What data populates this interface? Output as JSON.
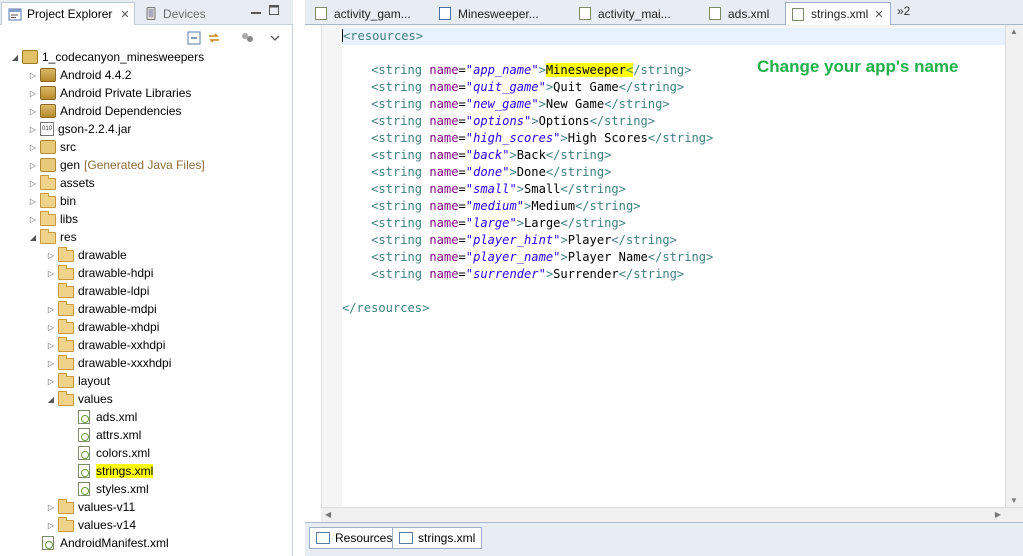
{
  "left_panel": {
    "tabs": [
      {
        "label": "Project Explorer",
        "active": true
      },
      {
        "label": "Devices",
        "active": false
      }
    ],
    "close_glyph": "✕",
    "tree": [
      {
        "label": "1_codecanyon_minesweepers",
        "icon": "project-icon",
        "twisty": "expanded",
        "depth": 0
      },
      {
        "label": "Android 4.4.2",
        "icon": "library-icon",
        "twisty": "collapsed",
        "depth": 1
      },
      {
        "label": "Android Private Libraries",
        "icon": "library-icon",
        "twisty": "collapsed",
        "depth": 1
      },
      {
        "label": "Android Dependencies",
        "icon": "library-icon",
        "twisty": "collapsed",
        "depth": 1
      },
      {
        "label": "gson-2.2.4.jar",
        "icon": "jar-icon",
        "twisty": "collapsed",
        "depth": 1
      },
      {
        "label": "src",
        "icon": "source-folder-icon",
        "twisty": "collapsed",
        "depth": 1
      },
      {
        "label": "gen",
        "extra": "[Generated Java Files]",
        "icon": "source-folder-icon",
        "twisty": "collapsed",
        "depth": 1
      },
      {
        "label": "assets",
        "icon": "folder-icon",
        "twisty": "collapsed",
        "depth": 1
      },
      {
        "label": "bin",
        "icon": "folder-icon",
        "twisty": "collapsed",
        "depth": 1
      },
      {
        "label": "libs",
        "icon": "folder-icon",
        "twisty": "collapsed",
        "depth": 1
      },
      {
        "label": "res",
        "icon": "folder-icon",
        "twisty": "expanded",
        "depth": 1
      },
      {
        "label": "drawable",
        "icon": "folder-icon",
        "twisty": "collapsed",
        "depth": 2
      },
      {
        "label": "drawable-hdpi",
        "icon": "folder-icon",
        "twisty": "collapsed",
        "depth": 2
      },
      {
        "label": "drawable-ldpi",
        "icon": "folder-icon",
        "twisty": "none",
        "depth": 2
      },
      {
        "label": "drawable-mdpi",
        "icon": "folder-icon",
        "twisty": "collapsed",
        "depth": 2
      },
      {
        "label": "drawable-xhdpi",
        "icon": "folder-icon",
        "twisty": "collapsed",
        "depth": 2
      },
      {
        "label": "drawable-xxhdpi",
        "icon": "folder-icon",
        "twisty": "collapsed",
        "depth": 2
      },
      {
        "label": "drawable-xxxhdpi",
        "icon": "folder-icon",
        "twisty": "collapsed",
        "depth": 2
      },
      {
        "label": "layout",
        "icon": "folder-icon",
        "twisty": "collapsed",
        "depth": 2
      },
      {
        "label": "values",
        "icon": "folder-icon",
        "twisty": "expanded",
        "depth": 2
      },
      {
        "label": "ads.xml",
        "icon": "xml-file-icon",
        "twisty": "none",
        "depth": 3
      },
      {
        "label": "attrs.xml",
        "icon": "xml-file-icon",
        "twisty": "none",
        "depth": 3
      },
      {
        "label": "colors.xml",
        "icon": "xml-file-icon",
        "twisty": "none",
        "depth": 3
      },
      {
        "label": "strings.xml",
        "icon": "xml-file-icon",
        "twisty": "none",
        "depth": 3,
        "highlighted": true
      },
      {
        "label": "styles.xml",
        "icon": "xml-file-icon",
        "twisty": "none",
        "depth": 3
      },
      {
        "label": "values-v11",
        "icon": "folder-icon",
        "twisty": "collapsed",
        "depth": 2
      },
      {
        "label": "values-v14",
        "icon": "folder-icon",
        "twisty": "collapsed",
        "depth": 2
      },
      {
        "label": "AndroidManifest.xml",
        "icon": "xml-file-icon",
        "twisty": "none",
        "depth": 1
      }
    ]
  },
  "editor": {
    "tabs": [
      {
        "label": "activity_gam...",
        "icon": "xml-file-icon",
        "active": false
      },
      {
        "label": "Minesweeper...",
        "icon": "java-file-icon",
        "active": false
      },
      {
        "label": "activity_mai...",
        "icon": "xml-file-icon",
        "active": false
      },
      {
        "label": "ads.xml",
        "icon": "xml-file-icon",
        "active": false
      },
      {
        "label": "strings.xml",
        "icon": "xml-file-icon",
        "active": true
      }
    ],
    "overflow_label": "»2",
    "code": {
      "open_tag": "<resources>",
      "close_tag": "</resources>",
      "strings": [
        {
          "name": "app_name",
          "value": "Minesweeper",
          "highlighted": true
        },
        {
          "name": "quit_game",
          "value": "Quit Game"
        },
        {
          "name": "new_game",
          "value": "New Game"
        },
        {
          "name": "options",
          "value": "Options"
        },
        {
          "name": "high_scores",
          "value": "High Scores"
        },
        {
          "name": "back",
          "value": "Back"
        },
        {
          "name": "done",
          "value": "Done"
        },
        {
          "name": "small",
          "value": "Small"
        },
        {
          "name": "medium",
          "value": "Medium"
        },
        {
          "name": "large",
          "value": "Large"
        },
        {
          "name": "player_hint",
          "value": "Player"
        },
        {
          "name": "player_name",
          "value": "Player Name"
        },
        {
          "name": "surrender",
          "value": "Surrender"
        }
      ]
    },
    "annotation": "Change your app's name",
    "bottom_tabs": [
      {
        "label": "Resources",
        "active": false
      },
      {
        "label": "strings.xml",
        "active": true
      }
    ]
  },
  "colors": {
    "highlight": "#ffff00",
    "annotation": "#22b04a",
    "xml_tag": "#3f7f7f",
    "xml_attr": "#7f007f",
    "xml_value": "#2a00ff"
  }
}
